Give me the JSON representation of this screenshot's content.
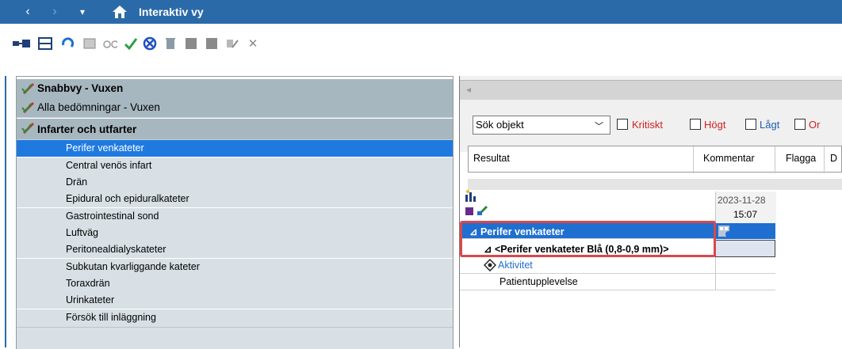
{
  "titlebar": {
    "back_icon": "‹",
    "forward_icon": "›",
    "menu_icon": "▾",
    "home_icon": "home",
    "title": "Interaktiv vy",
    "bg": "#2b6aa8"
  },
  "toolbar": {
    "icons": [
      "view-toggle-icon",
      "table-icon",
      "undo-icon",
      "sheet-icon",
      "glasses-icon",
      "checkmark-icon",
      "cancel-circle-icon",
      "trash-icon",
      "gray-square-icon",
      "gray-square2-icon",
      "edit-icon",
      "close-icon"
    ]
  },
  "left": {
    "categories": [
      "Snabbvy - Vuxen",
      "Alla bedömningar - Vuxen",
      "Infarter och utfarter"
    ],
    "items": [
      "Perifer venkateter",
      "Central venös infart",
      "Drän",
      "Epidural och epiduralkateter",
      "Gastrointestinal sond",
      "Luftväg",
      "Peritonealdialyskateter",
      "Subkutan kvarliggande kateter",
      "Toraxdrän",
      "Urinkateter",
      "Försök till inläggning"
    ],
    "selected_index": 0
  },
  "right": {
    "search_select": "Sök objekt",
    "flags": [
      {
        "label": "Kritiskt",
        "color": "#d42020"
      },
      {
        "label": "Högt",
        "color": "#d42020"
      },
      {
        "label": "Lågt",
        "color": "#1f5fb0"
      },
      {
        "label": "Or",
        "color": "#d42020"
      }
    ],
    "columns": [
      "Resultat",
      "Kommentar",
      "Flagga",
      "D"
    ],
    "date": "2023-11-28",
    "time": "15:07",
    "rows": [
      {
        "label": "⊿ Perifer venkateter",
        "type": "group"
      },
      {
        "label": "⊿ <Perifer venkateter Blå (0,8-0,9 mm)>",
        "type": "subgroup"
      },
      {
        "label": "Aktivitet",
        "type": "link"
      },
      {
        "label": "Patientupplevelse",
        "type": "plain"
      }
    ]
  },
  "colors": {
    "selected": "#1f7ae0",
    "category": "#a7b7c0",
    "item": "#d8e0e5",
    "highlight": "#d9474c"
  }
}
